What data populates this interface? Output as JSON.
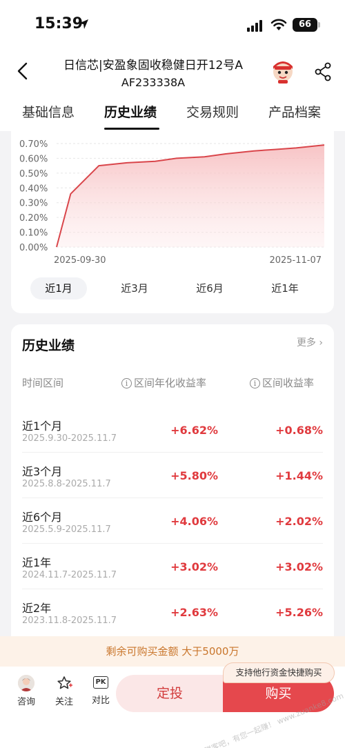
{
  "status": {
    "time": "15:39",
    "battery": "66"
  },
  "header": {
    "title_line1": "日信芯|安盈象固收稳健日开12号A",
    "title_line2": "AF233338A",
    "tabs": [
      {
        "label": "基础信息"
      },
      {
        "label": "历史业绩"
      },
      {
        "label": "交易规则"
      },
      {
        "label": "产品档案"
      }
    ]
  },
  "chart_data": {
    "type": "area",
    "x": [
      "2025-09-30",
      "2025-10-02",
      "2025-10-06",
      "2025-10-10",
      "2025-10-14",
      "2025-10-17",
      "2025-10-21",
      "2025-10-24",
      "2025-10-28",
      "2025-10-31",
      "2025-11-03",
      "2025-11-05",
      "2025-11-07"
    ],
    "y": [
      0.0,
      0.36,
      0.55,
      0.57,
      0.58,
      0.6,
      0.61,
      0.63,
      0.65,
      0.66,
      0.67,
      0.68,
      0.69
    ],
    "y_ticks": [
      "0.70%",
      "0.60%",
      "0.50%",
      "0.40%",
      "0.30%",
      "0.20%",
      "0.10%",
      "0.00%"
    ],
    "x_tick_labels": [
      "2025-09-30",
      "2025-11-07"
    ],
    "ylim": [
      0,
      0.7
    ],
    "grid": true,
    "color": "#d9454a"
  },
  "ranges": [
    {
      "label": "近1月",
      "active": true
    },
    {
      "label": "近3月"
    },
    {
      "label": "近6月"
    },
    {
      "label": "近1年"
    }
  ],
  "performance": {
    "title": "历史业绩",
    "more": "更多",
    "headers": {
      "period": "时间区间",
      "annualized": "区间年化收益率",
      "interval": "区间收益率"
    },
    "rows": [
      {
        "name": "近1个月",
        "date": "2025.9.30-2025.11.7",
        "annualized": "+6.62%",
        "interval": "+0.68%"
      },
      {
        "name": "近3个月",
        "date": "2025.8.8-2025.11.7",
        "annualized": "+5.80%",
        "interval": "+1.44%"
      },
      {
        "name": "近6个月",
        "date": "2025.5.9-2025.11.7",
        "annualized": "+4.06%",
        "interval": "+2.02%"
      },
      {
        "name": "近1年",
        "date": "2024.11.7-2025.11.7",
        "annualized": "+3.02%",
        "interval": "+3.02%"
      },
      {
        "name": "近2年",
        "date": "2023.11.8-2025.11.7",
        "annualized": "+2.63%",
        "interval": "+5.26%"
      }
    ]
  },
  "notice": "剩余可购买金额  大于5000万",
  "bottom": {
    "consult": "咨询",
    "follow": "关注",
    "compare": "对比",
    "pk": "PK",
    "dingtou": "定投",
    "buy": "购买",
    "tooltip": "支持他行资金快捷购买"
  },
  "watermark": "赚客吧，有您一起赚！ www.zuanke8.com"
}
